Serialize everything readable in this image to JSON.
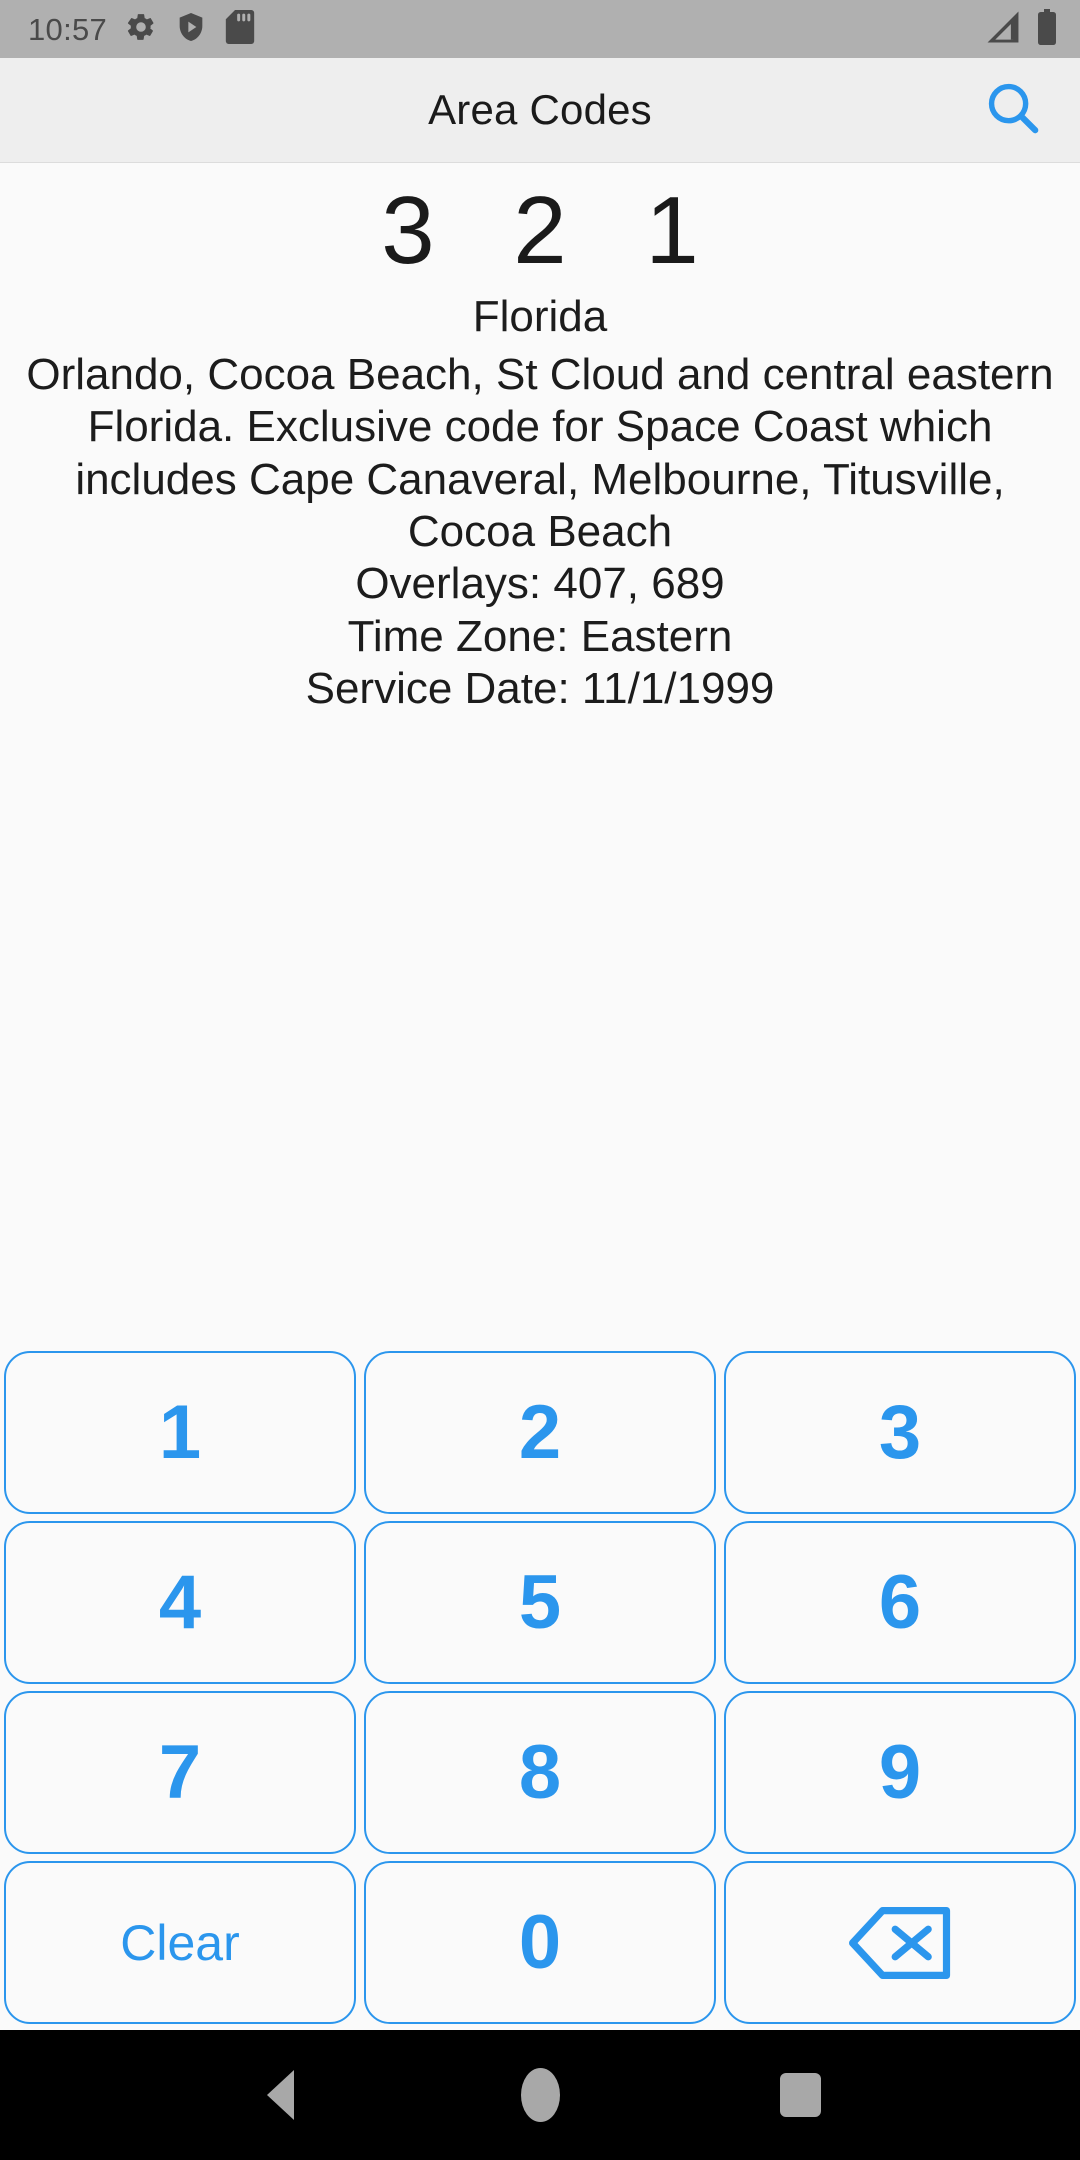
{
  "status_bar": {
    "time": "10:57",
    "icons_left": [
      "gear-icon",
      "play-protect-shield-icon",
      "sd-card-icon"
    ],
    "icons_right": [
      "cell-signal-icon",
      "battery-full-icon"
    ]
  },
  "app_bar": {
    "title": "Area Codes",
    "search_icon": "search-icon"
  },
  "detail": {
    "area_code": "3 2 1",
    "state": "Florida",
    "description": "Orlando, Cocoa Beach, St Cloud and central eastern Florida. Exclusive code for Space Coast which includes Cape Canaveral, Melbourne, Titusville, Cocoa Beach",
    "overlays": "Overlays: 407, 689",
    "time_zone": "Time Zone: Eastern",
    "service_date": "Service Date: 11/1/1999"
  },
  "keypad": {
    "rows": [
      [
        {
          "label": "1",
          "type": "digit",
          "name": "key-1"
        },
        {
          "label": "2",
          "type": "digit",
          "name": "key-2"
        },
        {
          "label": "3",
          "type": "digit",
          "name": "key-3"
        }
      ],
      [
        {
          "label": "4",
          "type": "digit",
          "name": "key-4"
        },
        {
          "label": "5",
          "type": "digit",
          "name": "key-5"
        },
        {
          "label": "6",
          "type": "digit",
          "name": "key-6"
        }
      ],
      [
        {
          "label": "7",
          "type": "digit",
          "name": "key-7"
        },
        {
          "label": "8",
          "type": "digit",
          "name": "key-8"
        },
        {
          "label": "9",
          "type": "digit",
          "name": "key-9"
        }
      ],
      [
        {
          "label": "Clear",
          "type": "word",
          "name": "key-clear"
        },
        {
          "label": "0",
          "type": "digit",
          "name": "key-0"
        },
        {
          "label": "",
          "type": "icon",
          "name": "key-backspace",
          "icon": "backspace-icon"
        }
      ]
    ]
  },
  "nav_bar": {
    "back": "back-icon",
    "home": "home-icon",
    "recents": "recents-icon"
  },
  "colors": {
    "accent_blue": "#2b96ed",
    "status_bar_bg": "#b0b0b0",
    "app_bar_bg": "#eeeeee",
    "content_bg": "#fafafa",
    "nav_bar_bg": "#000000"
  }
}
